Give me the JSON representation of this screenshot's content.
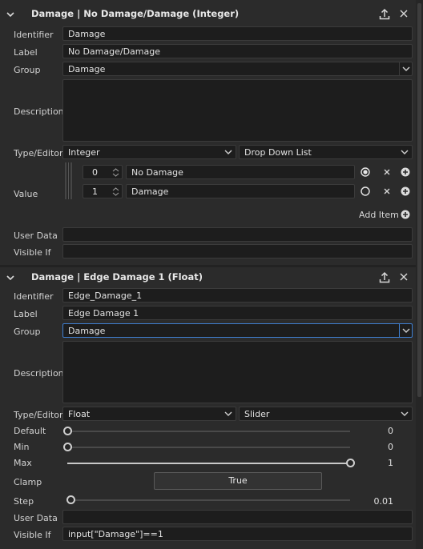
{
  "params": [
    {
      "title": "Damage | No Damage/Damage (Integer)",
      "identifier_label": "Identifier",
      "identifier": "Damage",
      "label_label": "Label",
      "label": "No Damage/Damage",
      "group_label": "Group",
      "group": "Damage",
      "description_label": "Description",
      "type_editor_label": "Type/Editor",
      "type": "Integer",
      "editor": "Drop Down List",
      "value_label": "Value",
      "items": [
        {
          "value": "0",
          "name": "No Damage",
          "selected": true
        },
        {
          "value": "1",
          "name": "Damage",
          "selected": false
        }
      ],
      "add_item_label": "Add Item",
      "user_data_label": "User Data",
      "user_data": "",
      "visible_if_label": "Visible If",
      "visible_if": ""
    },
    {
      "title": "Damage | Edge Damage 1 (Float)",
      "identifier_label": "Identifier",
      "identifier": "Edge_Damage_1",
      "label_label": "Label",
      "label": "Edge Damage 1",
      "group_label": "Group",
      "group": "Damage",
      "description_label": "Description",
      "type_editor_label": "Type/Editor",
      "type": "Float",
      "editor": "Slider",
      "default_label": "Default",
      "default": "0",
      "default_frac": 0,
      "min_label": "Min",
      "min": "0",
      "min_frac": 0,
      "max_label": "Max",
      "max": "1",
      "max_frac": 1,
      "clamp_label": "Clamp",
      "clamp": "True",
      "step_label": "Step",
      "step": "0.01",
      "step_frac": 0.01,
      "user_data_label": "User Data",
      "user_data": "",
      "visible_if_label": "Visible If",
      "visible_if": "input[\"Damage\"]==1"
    }
  ]
}
